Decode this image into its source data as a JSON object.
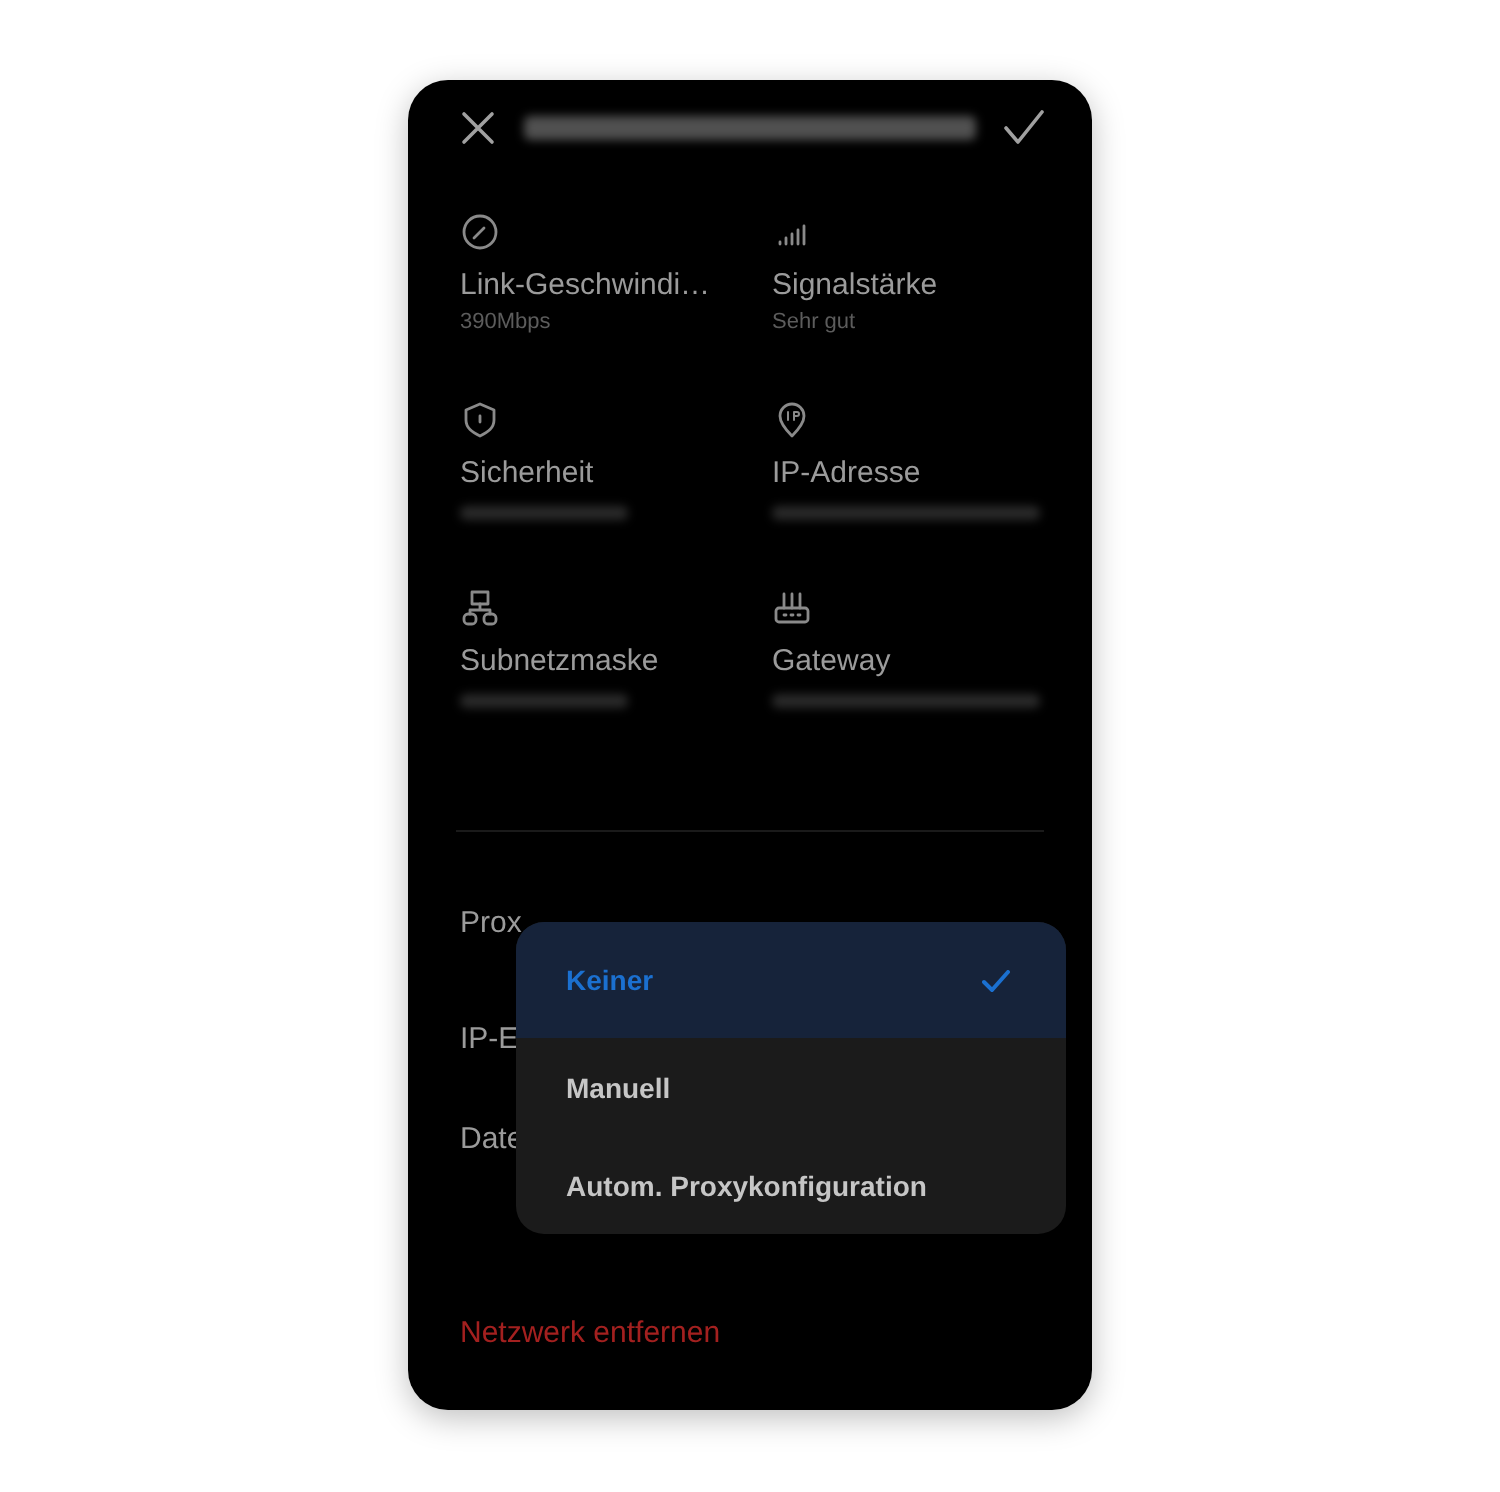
{
  "details": [
    {
      "label": "Link-Geschwindi…",
      "value": "390Mbps"
    },
    {
      "label": "Signalstärke",
      "value": "Sehr gut"
    },
    {
      "label": "Sicherheit",
      "blurred": true
    },
    {
      "label": "IP-Adresse",
      "blurred": true
    },
    {
      "label": "Subnetzmaske",
      "blurred": true
    },
    {
      "label": "Gateway",
      "blurred": true
    }
  ],
  "settings": [
    {
      "label": "Prox"
    },
    {
      "label": "IP-E"
    },
    {
      "label": "Date"
    }
  ],
  "actions": [
    {
      "kind": "danger",
      "label": "Netzwerk entfernen"
    }
  ],
  "menu": [
    {
      "label": "Keiner",
      "selected": true
    },
    {
      "label": "Manuell",
      "selected": false
    },
    {
      "label": "Autom. Proxykonfiguration",
      "selected": false
    }
  ]
}
